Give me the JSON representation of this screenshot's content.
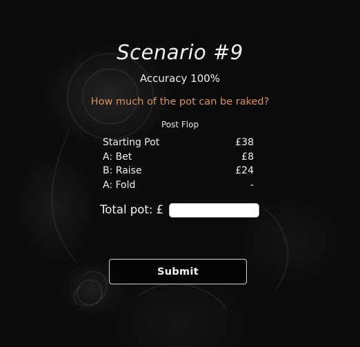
{
  "scenario": {
    "title": "Scenario #9",
    "accuracy": "Accuracy 100%",
    "question": "How much of the pot can be raked?",
    "street": "Post Flop"
  },
  "actions": [
    {
      "label": "Starting Pot",
      "amount": "£38"
    },
    {
      "label": "A: Bet",
      "amount": "£8"
    },
    {
      "label": "B: Raise",
      "amount": "£24"
    },
    {
      "label": "A: Fold",
      "amount": "-"
    }
  ],
  "total": {
    "label": "Total pot: £",
    "value": "",
    "placeholder": ""
  },
  "submit_label": "Submit",
  "colors": {
    "background": "#0b0b0b",
    "question_accent": "#d9925a",
    "text": "#f2f2f2"
  }
}
